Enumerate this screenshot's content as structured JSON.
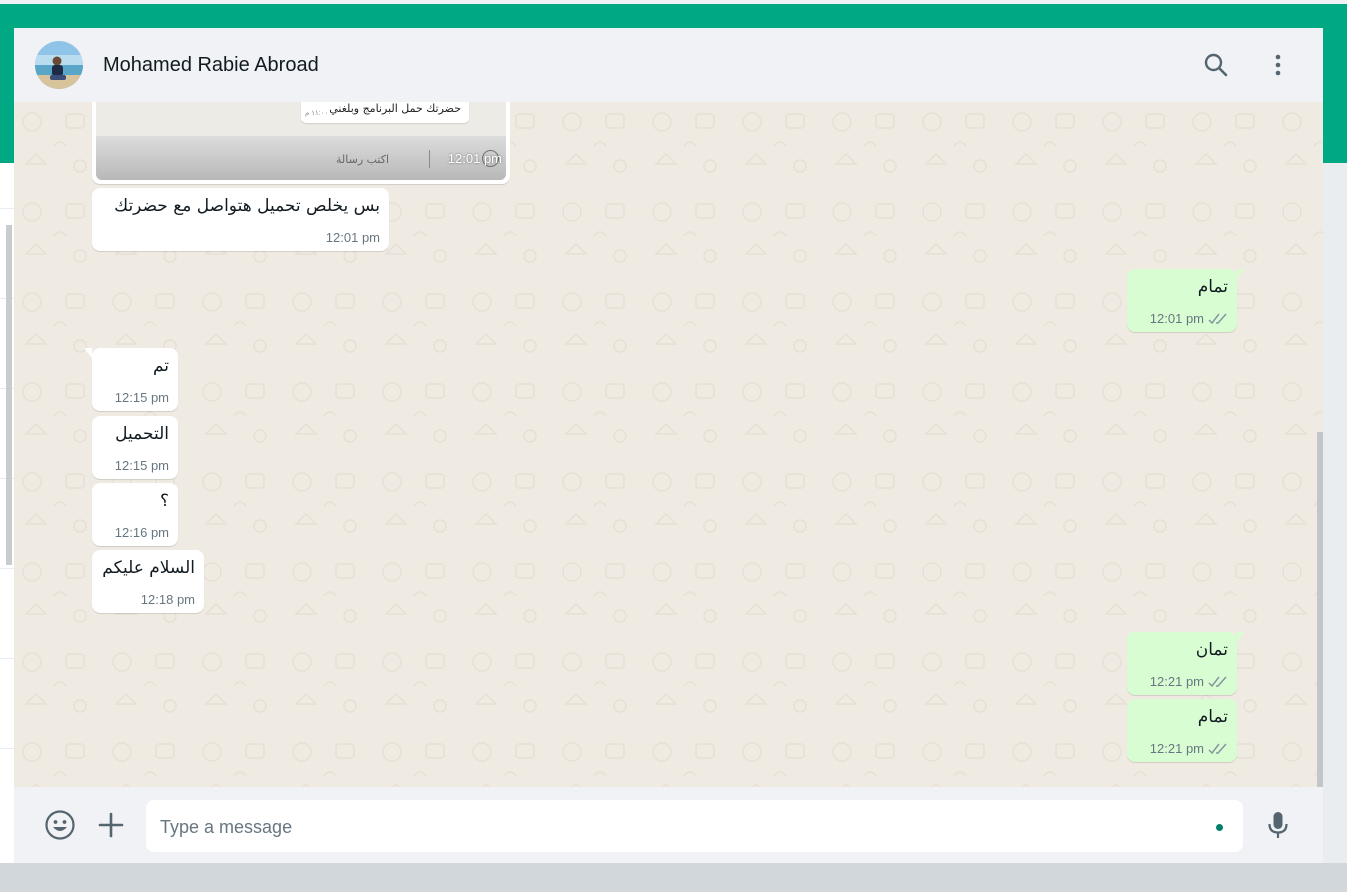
{
  "header": {
    "contact_name": "Mohamed Rabie Abroad",
    "avatar_alt": "contact-avatar"
  },
  "image_message": {
    "preview_text": "حضرتك حمل البرنامج وبلغني",
    "preview_sub": "١١:٠٠ م",
    "input_preview": "اكتب رسالة",
    "time": "12:01 pm"
  },
  "messages": [
    {
      "dir": "in",
      "text": "بس يخلص تحميل هتواصل مع حضرتك",
      "time": "12:01 pm"
    },
    {
      "dir": "out",
      "text": "تمام",
      "time": "12:01 pm"
    },
    {
      "dir": "in",
      "text": "تم",
      "time": "12:15 pm"
    },
    {
      "dir": "in",
      "text": "التحميل",
      "time": "12:15 pm"
    },
    {
      "dir": "in",
      "text": "؟",
      "time": "12:16 pm"
    },
    {
      "dir": "in",
      "text": "السلام عليكم",
      "time": "12:18 pm"
    },
    {
      "dir": "out",
      "text": "تمان",
      "time": "12:21 pm"
    },
    {
      "dir": "out",
      "text": "تمام",
      "time": "12:21 pm"
    }
  ],
  "composer": {
    "placeholder": "Type a message"
  },
  "icons": {
    "search": "search-icon",
    "menu": "kebab-menu-icon",
    "emoji": "emoji-icon",
    "attach": "plus-icon",
    "mic": "microphone-icon",
    "read": "double-check-icon"
  },
  "colors": {
    "accent_band": "#00a884",
    "outgoing_bubble": "#d9fdd3",
    "incoming_bubble": "#ffffff",
    "chat_background": "#efeae2",
    "panel": "#f0f2f5"
  }
}
